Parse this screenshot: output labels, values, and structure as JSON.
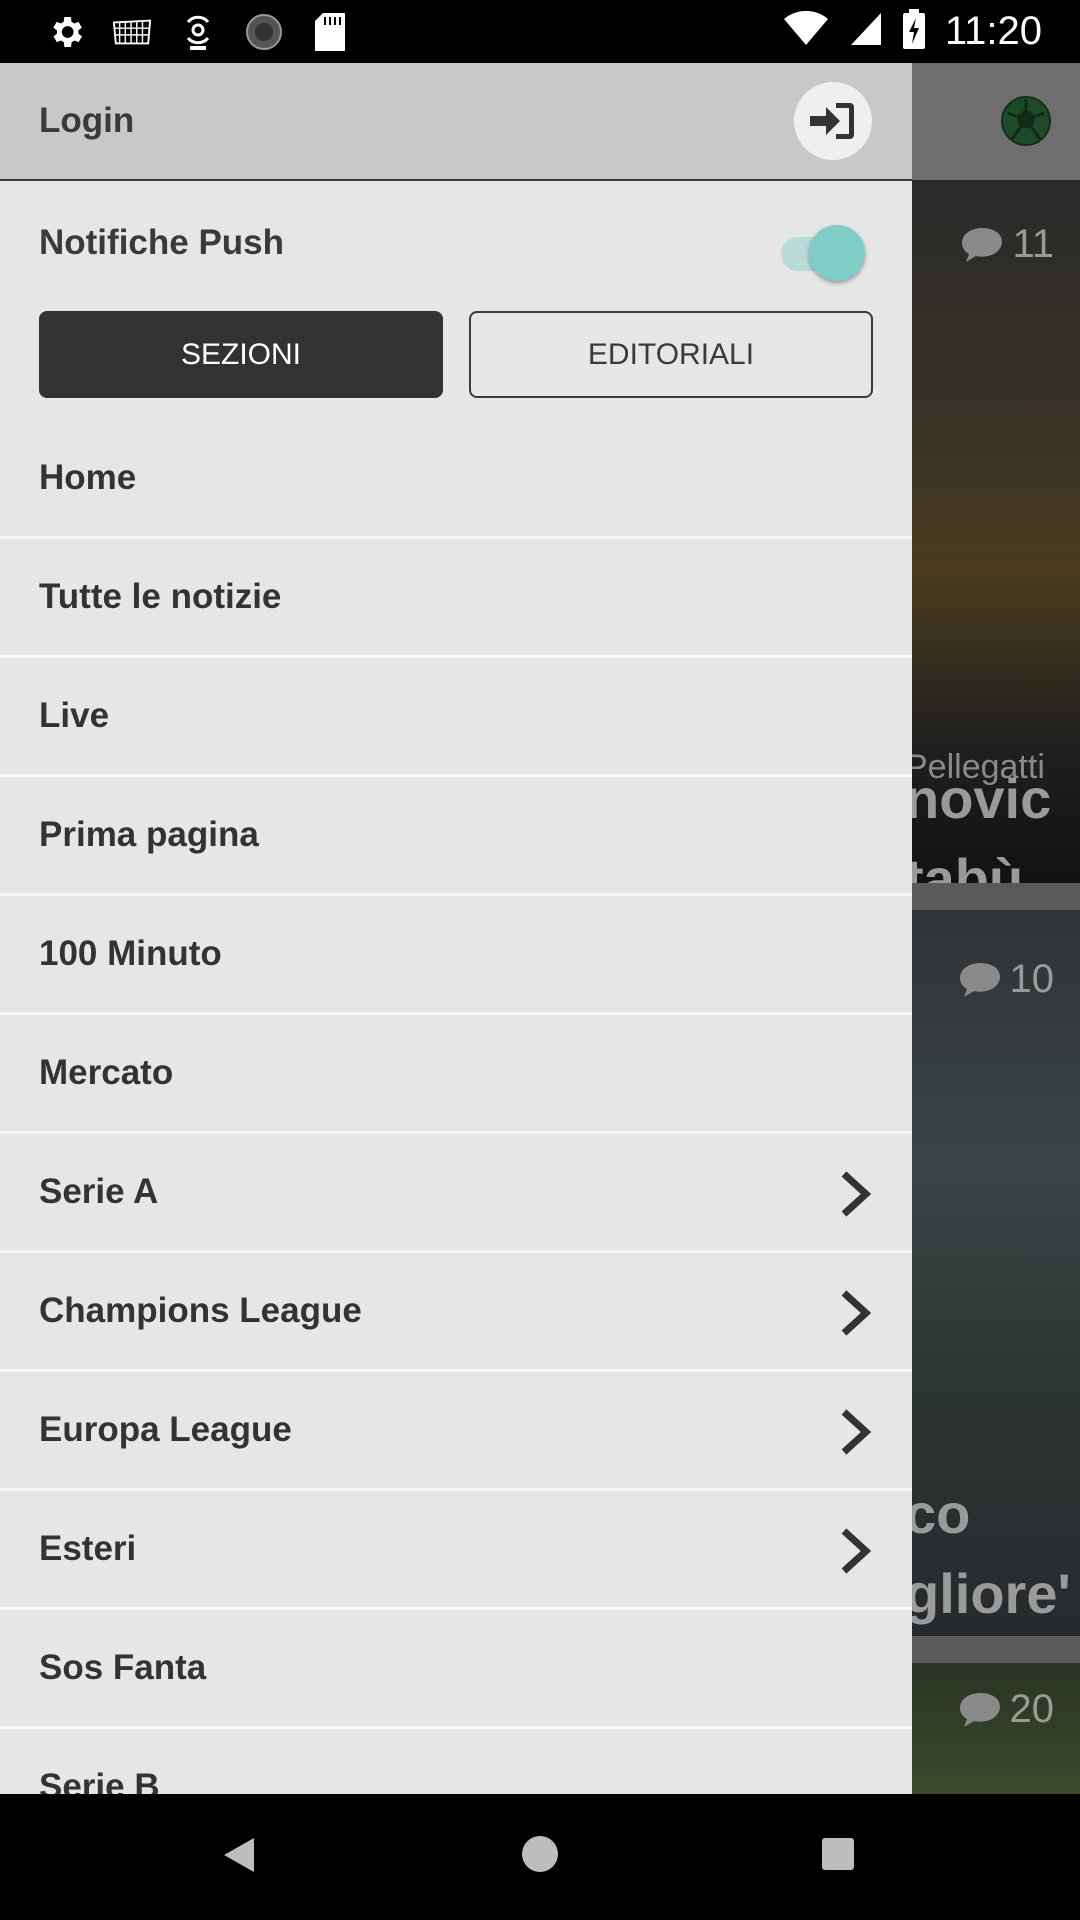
{
  "status_bar": {
    "time": "11:20",
    "left_icons": [
      "gear-icon",
      "keyboard-icon",
      "hotspot-icon",
      "sync-icon",
      "sd-card-icon"
    ],
    "right_icons": [
      "wifi-icon",
      "signal-icon",
      "battery-charging-icon"
    ]
  },
  "drawer": {
    "login_label": "Login",
    "login_icon": "sign-in-icon",
    "push_label": "Notifiche Push",
    "push_enabled": true,
    "accent_color": "#7fcdc7",
    "tabs": {
      "selected": "SEZIONI",
      "other": "EDITORIALI"
    },
    "menu": [
      {
        "label": "Home",
        "has_submenu": false
      },
      {
        "label": "Tutte le notizie",
        "has_submenu": false
      },
      {
        "label": "Live",
        "has_submenu": false
      },
      {
        "label": "Prima pagina",
        "has_submenu": false
      },
      {
        "label": "100 Minuto",
        "has_submenu": false
      },
      {
        "label": "Mercato",
        "has_submenu": false
      },
      {
        "label": "Serie A",
        "has_submenu": true
      },
      {
        "label": "Champions League",
        "has_submenu": true
      },
      {
        "label": "Europa League",
        "has_submenu": true
      },
      {
        "label": "Esteri",
        "has_submenu": true
      },
      {
        "label": "Sos Fanta",
        "has_submenu": false
      },
      {
        "label": "Serie B",
        "has_submenu": false
      }
    ]
  },
  "background_feed": {
    "header_icon": "soccer-ball-icon",
    "cards": [
      {
        "comments": "11",
        "author_fragment": "Pellegatti",
        "title_fragment_1": "novic",
        "title_fragment_2": "tabù"
      },
      {
        "comments": "10",
        "title_fragment_1": "co",
        "title_fragment_2": "gliore'"
      },
      {
        "comments": "20"
      }
    ]
  }
}
